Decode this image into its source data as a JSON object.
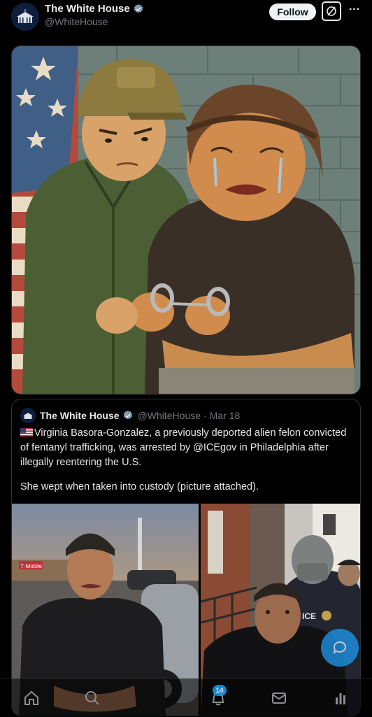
{
  "post": {
    "author_name": "The White House",
    "author_handle": "@WhiteHouse",
    "follow_label": "Follow",
    "more_label": "···"
  },
  "quoted": {
    "author_name": "The White House",
    "author_handle": "@WhiteHouse",
    "separator": "·",
    "date": "Mar 18",
    "text_line1": "Virginia Basora-Gonzalez, a previously deported alien felon convicted of fentanyl trafficking, was arrested by @ICEgov in Philadelphia after illegally reentering the U.S.",
    "text_line2": "She wept when taken into custody (picture attached)."
  },
  "photo_left": {
    "store_sign": "T·Mobile"
  },
  "photo_right": {
    "vest_text": "ICE"
  },
  "nav": {
    "items": [
      "home-icon",
      "search-icon",
      "notifications-icon",
      "messages-icon",
      "grok-icon"
    ],
    "notification_count": "14"
  },
  "colors": {
    "accent": "#1d9bf0",
    "background": "#000000",
    "text": "#e7e9ea",
    "muted": "#71767b",
    "border": "#2f3336"
  }
}
